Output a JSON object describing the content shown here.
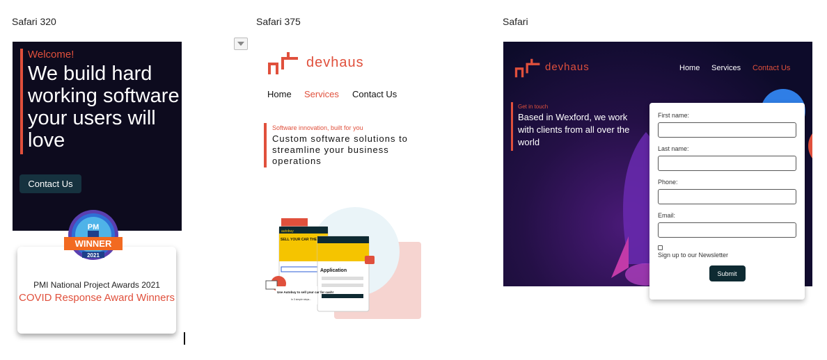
{
  "labels": {
    "frame1": "Safari 320",
    "frame2": "Safari 375",
    "frame3": "Safari"
  },
  "frame1": {
    "welcome": "Welcome!",
    "heading": "We build hard working software your users will love",
    "cta": "Contact Us",
    "badge": {
      "top": "PM",
      "ribbon": "WINNER",
      "year": "2021"
    },
    "award_line1": "PMI National Project Awards 2021",
    "award_line2": "COVID Response Award Winners"
  },
  "frame2": {
    "logo": "devhaus",
    "nav": [
      "Home",
      "Services",
      "Contact Us"
    ],
    "active_nav": "Services",
    "subheading": "Software innovation, built for you",
    "heading": "Custom software solutions to streamline your business operations",
    "illustration": {
      "brand": "autobuy",
      "title": "SELL YOUR CAR THE EASY WAY",
      "app_title": "Application",
      "caption": "Use Autobuy to sell your car for cash!",
      "steps": "In 3 simple steps..."
    }
  },
  "frame3": {
    "logo": "devhaus",
    "nav": [
      "Home",
      "Services",
      "Contact Us"
    ],
    "active_nav": "Contact Us",
    "subheading": "Get in touch",
    "heading": "Based in Wexford, we work with clients from all over the world",
    "form": {
      "first_name": "First name:",
      "last_name": "Last name:",
      "phone": "Phone:",
      "email": "Email:",
      "newsletter": "Sign up to our Newsletter",
      "submit": "Submit"
    }
  },
  "colors": {
    "accent": "#e0503c",
    "dark_bg": "#0d0b1e",
    "button_dark": "#0e2a32"
  },
  "icons": [
    "devhaus-logo-icon",
    "dropdown-toggle-icon",
    "award-badge-icon",
    "rocket-illustration"
  ]
}
